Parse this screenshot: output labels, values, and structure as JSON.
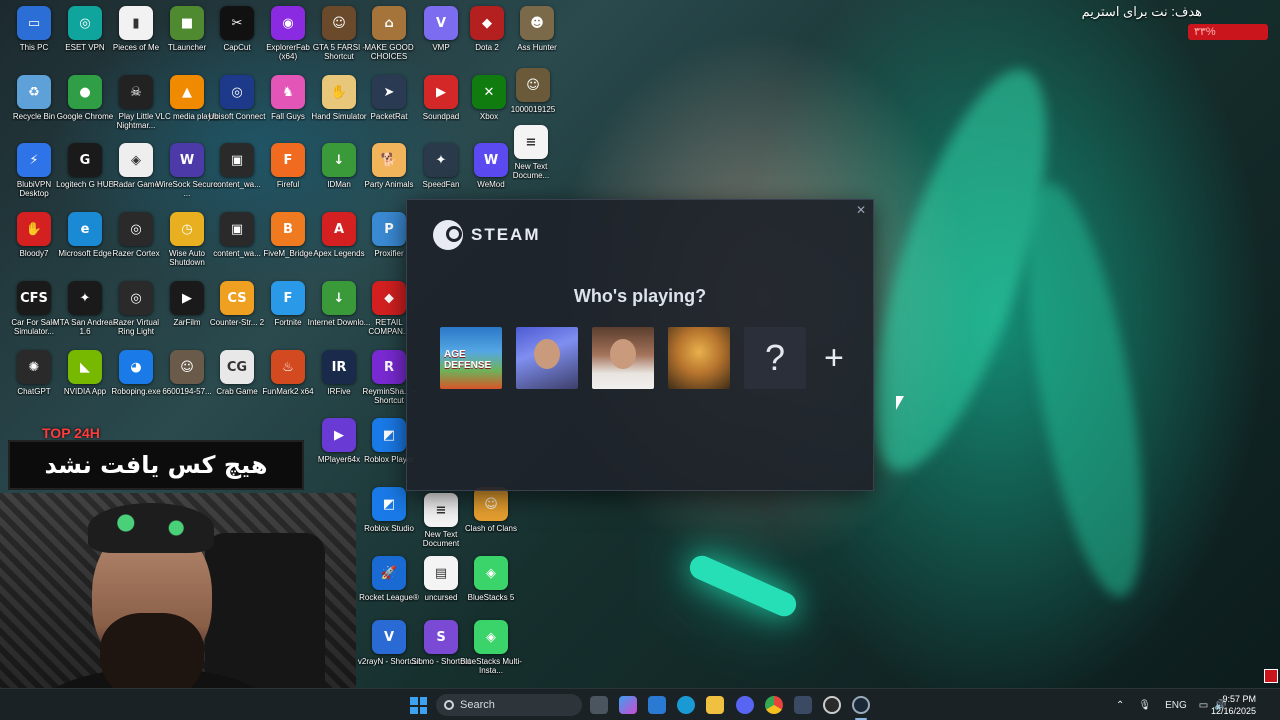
{
  "desktop": {
    "icons": [
      {
        "label": "This PC",
        "color": "#2b6fd6",
        "glyph": "▭"
      },
      {
        "label": "ESET VPN",
        "color": "#10a59c",
        "glyph": "◎"
      },
      {
        "label": "Pieces of Me",
        "color": "#f2f2f2",
        "glyph": "▮"
      },
      {
        "label": "TLauncher",
        "color": "#4f8a30",
        "glyph": "■"
      },
      {
        "label": "CapCut",
        "color": "#111111",
        "glyph": "✂"
      },
      {
        "label": "ExplorerFab (x64)",
        "color": "#8a2be2",
        "glyph": "◉"
      },
      {
        "label": "GTA 5 FARSI - Shortcut",
        "color": "#6a4a2a",
        "glyph": "☺"
      },
      {
        "label": "MAKE GOOD CHOICES",
        "color": "#a5743a",
        "glyph": "⌂"
      },
      {
        "label": "VMP",
        "color": "#7b6cf0",
        "glyph": "V"
      },
      {
        "label": "Dota 2",
        "color": "#b41f1f",
        "glyph": "◆"
      },
      {
        "label": "Ass Hunter",
        "color": "#7a6a4a",
        "glyph": "☻"
      },
      {
        "label": "Recycle Bin",
        "color": "#5ea0d8",
        "glyph": "♻"
      },
      {
        "label": "Google Chrome",
        "color": "#2f9e44",
        "glyph": "●"
      },
      {
        "label": "Play Little Nightmar...",
        "color": "#222222",
        "glyph": "☠"
      },
      {
        "label": "VLC media player",
        "color": "#f08a00",
        "glyph": "▲"
      },
      {
        "label": "Ubisoft Connect",
        "color": "#1d3a8a",
        "glyph": "◎"
      },
      {
        "label": "Fall Guys",
        "color": "#e455b8",
        "glyph": "♞"
      },
      {
        "label": "Hand Simulator",
        "color": "#e8c77a",
        "glyph": "✋"
      },
      {
        "label": "PacketRat",
        "color": "#2a3a52",
        "glyph": "➤"
      },
      {
        "label": "Soundpad",
        "color": "#d42727",
        "glyph": "▶"
      },
      {
        "label": "Xbox",
        "color": "#107c10",
        "glyph": "✕"
      },
      {
        "label": "1000019125",
        "color": "#6a5a3a",
        "glyph": "☺"
      },
      {
        "label": "BlubiVPN Desktop",
        "color": "#2e74e8",
        "glyph": "⚡"
      },
      {
        "label": "Logitech G HUB",
        "color": "#1a1a1a",
        "glyph": "G"
      },
      {
        "label": "Radar Game",
        "color": "#eeeeee",
        "glyph": "◈"
      },
      {
        "label": "WireSock Secure ...",
        "color": "#4b3aa8",
        "glyph": "W"
      },
      {
        "label": "content_wa...",
        "color": "#2a2a2a",
        "glyph": "▣"
      },
      {
        "label": "Fireful",
        "color": "#f06a20",
        "glyph": "F"
      },
      {
        "label": "IDMan",
        "color": "#3a9a3a",
        "glyph": "↓"
      },
      {
        "label": "Party Animals",
        "color": "#f2b45a",
        "glyph": "🐕"
      },
      {
        "label": "SpeedFan",
        "color": "#2a3a4a",
        "glyph": "✦"
      },
      {
        "label": "WeMod",
        "color": "#5a4af0",
        "glyph": "W"
      },
      {
        "label": "New Text Docume...",
        "color": "#f4f4f4",
        "glyph": "≡"
      },
      {
        "label": "Bloody7",
        "color": "#d42020",
        "glyph": "✋"
      },
      {
        "label": "Microsoft Edge",
        "color": "#1a8ad4",
        "glyph": "e"
      },
      {
        "label": "Razer Cortex",
        "color": "#2a2a2a",
        "glyph": "◎"
      },
      {
        "label": "Wise Auto Shutdown",
        "color": "#e8b020",
        "glyph": "◷"
      },
      {
        "label": "content_wa...",
        "color": "#2a2a2a",
        "glyph": "▣"
      },
      {
        "label": "FiveM_Bridge",
        "color": "#f07a20",
        "glyph": "B"
      },
      {
        "label": "Apex Legends",
        "color": "#d42020",
        "glyph": "A"
      },
      {
        "label": "Proxifier",
        "color": "#3a8ad4",
        "glyph": "P"
      },
      {
        "label": "Car For Sale Simulator...",
        "color": "#1a1a1a",
        "glyph": "CFS"
      },
      {
        "label": "MTA San Andreas 1.6",
        "color": "#1a1a1a",
        "glyph": "✦"
      },
      {
        "label": "Razer Virtual Ring Light",
        "color": "#2a2a2a",
        "glyph": "◎"
      },
      {
        "label": "ZarFilm",
        "color": "#1a1a1a",
        "glyph": "▶"
      },
      {
        "label": "Counter-Str... 2",
        "color": "#f0a020",
        "glyph": "CS"
      },
      {
        "label": "Fortnite",
        "color": "#2a9ae8",
        "glyph": "F"
      },
      {
        "label": "Internet Downlo...",
        "color": "#3a9a3a",
        "glyph": "↓"
      },
      {
        "label": "RETAIL COMPAN...",
        "color": "#d42020",
        "glyph": "⬥"
      },
      {
        "label": "ChatGPT",
        "color": "#2a2a2a",
        "glyph": "✺"
      },
      {
        "label": "NVIDIA App",
        "color": "#76b900",
        "glyph": "◣"
      },
      {
        "label": "Roboping.exe",
        "color": "#1a7ae8",
        "glyph": "◕"
      },
      {
        "label": "6600194-57...",
        "color": "#6a5a4a",
        "glyph": "☺"
      },
      {
        "label": "Crab Game",
        "color": "#e8e8e8",
        "glyph": "CG"
      },
      {
        "label": "FunMark2 x64",
        "color": "#d44a20",
        "glyph": "♨"
      },
      {
        "label": "IRFive",
        "color": "#1a2a4a",
        "glyph": "IR"
      },
      {
        "label": "ReyminSha... - Shortcut",
        "color": "#7a2ad4",
        "glyph": "R"
      },
      {
        "label": "Roblox Studio",
        "color": "#1a7ae8",
        "glyph": "◩"
      },
      {
        "label": "New Text Document",
        "color": "#f4f4f4",
        "glyph": "≡"
      },
      {
        "label": "Clash of Clans",
        "color": "#e8a030",
        "glyph": "☺"
      },
      {
        "label": "Rocket League®",
        "color": "#1a6ad4",
        "glyph": "🚀"
      },
      {
        "label": "uncursed",
        "color": "#f4f4f4",
        "glyph": "▤"
      },
      {
        "label": "BlueStacks 5",
        "color": "#3ad46a",
        "glyph": "◈"
      },
      {
        "label": "v2rayN - Shortcut",
        "color": "#2a6ad4",
        "glyph": "V"
      },
      {
        "label": "Sibmo - Shortcut",
        "color": "#7a4ad4",
        "glyph": "S"
      },
      {
        "label": "BlueStacks Multi-Insta...",
        "color": "#3ad46a",
        "glyph": "◈"
      },
      {
        "label": "MPlayer64x",
        "color": "#6a3ad4",
        "glyph": "▶"
      },
      {
        "label": "Roblox Player",
        "color": "#1a7ae8",
        "glyph": "◩"
      }
    ]
  },
  "goal": {
    "label": "هدف: نت برای استریم",
    "bar_text": "۳۳%"
  },
  "steam": {
    "brand": "STEAM",
    "title": "Who's playing?",
    "close_glyph": "✕",
    "accounts": [
      {
        "overlay": "AGE DEFENSE"
      },
      {
        "overlay": ""
      },
      {
        "overlay": ""
      },
      {
        "overlay": ""
      },
      {
        "overlay": "?"
      }
    ],
    "add_glyph": "+"
  },
  "overlay": {
    "caption": "هیچ کس یافت نشد",
    "badge": "TOP 24H"
  },
  "taskbar": {
    "search_label": "Search",
    "lang": "ENG",
    "time": "9:57 PM",
    "date": "12/16/2025"
  }
}
